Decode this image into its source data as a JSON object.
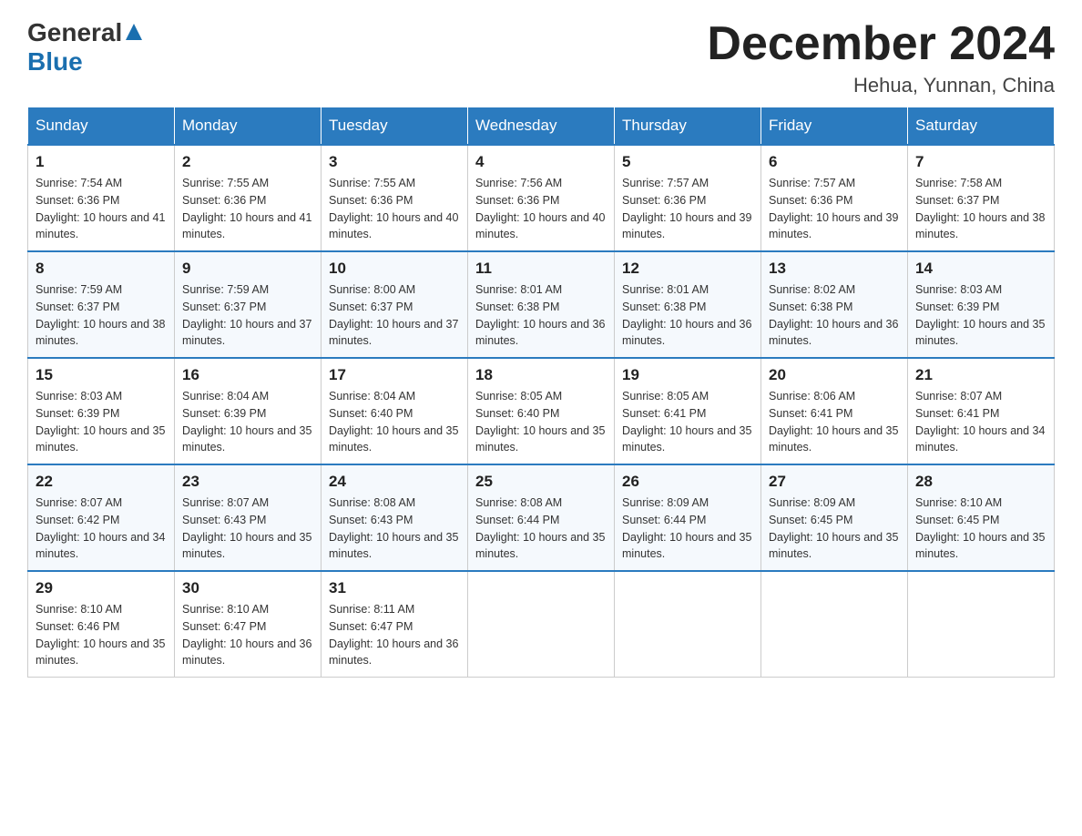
{
  "header": {
    "logo_general": "General",
    "logo_blue": "Blue",
    "month_title": "December 2024",
    "location": "Hehua, Yunnan, China"
  },
  "days_of_week": [
    "Sunday",
    "Monday",
    "Tuesday",
    "Wednesday",
    "Thursday",
    "Friday",
    "Saturday"
  ],
  "weeks": [
    [
      {
        "day": "1",
        "sunrise": "7:54 AM",
        "sunset": "6:36 PM",
        "daylight": "10 hours and 41 minutes."
      },
      {
        "day": "2",
        "sunrise": "7:55 AM",
        "sunset": "6:36 PM",
        "daylight": "10 hours and 41 minutes."
      },
      {
        "day": "3",
        "sunrise": "7:55 AM",
        "sunset": "6:36 PM",
        "daylight": "10 hours and 40 minutes."
      },
      {
        "day": "4",
        "sunrise": "7:56 AM",
        "sunset": "6:36 PM",
        "daylight": "10 hours and 40 minutes."
      },
      {
        "day": "5",
        "sunrise": "7:57 AM",
        "sunset": "6:36 PM",
        "daylight": "10 hours and 39 minutes."
      },
      {
        "day": "6",
        "sunrise": "7:57 AM",
        "sunset": "6:36 PM",
        "daylight": "10 hours and 39 minutes."
      },
      {
        "day": "7",
        "sunrise": "7:58 AM",
        "sunset": "6:37 PM",
        "daylight": "10 hours and 38 minutes."
      }
    ],
    [
      {
        "day": "8",
        "sunrise": "7:59 AM",
        "sunset": "6:37 PM",
        "daylight": "10 hours and 38 minutes."
      },
      {
        "day": "9",
        "sunrise": "7:59 AM",
        "sunset": "6:37 PM",
        "daylight": "10 hours and 37 minutes."
      },
      {
        "day": "10",
        "sunrise": "8:00 AM",
        "sunset": "6:37 PM",
        "daylight": "10 hours and 37 minutes."
      },
      {
        "day": "11",
        "sunrise": "8:01 AM",
        "sunset": "6:38 PM",
        "daylight": "10 hours and 36 minutes."
      },
      {
        "day": "12",
        "sunrise": "8:01 AM",
        "sunset": "6:38 PM",
        "daylight": "10 hours and 36 minutes."
      },
      {
        "day": "13",
        "sunrise": "8:02 AM",
        "sunset": "6:38 PM",
        "daylight": "10 hours and 36 minutes."
      },
      {
        "day": "14",
        "sunrise": "8:03 AM",
        "sunset": "6:39 PM",
        "daylight": "10 hours and 35 minutes."
      }
    ],
    [
      {
        "day": "15",
        "sunrise": "8:03 AM",
        "sunset": "6:39 PM",
        "daylight": "10 hours and 35 minutes."
      },
      {
        "day": "16",
        "sunrise": "8:04 AM",
        "sunset": "6:39 PM",
        "daylight": "10 hours and 35 minutes."
      },
      {
        "day": "17",
        "sunrise": "8:04 AM",
        "sunset": "6:40 PM",
        "daylight": "10 hours and 35 minutes."
      },
      {
        "day": "18",
        "sunrise": "8:05 AM",
        "sunset": "6:40 PM",
        "daylight": "10 hours and 35 minutes."
      },
      {
        "day": "19",
        "sunrise": "8:05 AM",
        "sunset": "6:41 PM",
        "daylight": "10 hours and 35 minutes."
      },
      {
        "day": "20",
        "sunrise": "8:06 AM",
        "sunset": "6:41 PM",
        "daylight": "10 hours and 35 minutes."
      },
      {
        "day": "21",
        "sunrise": "8:07 AM",
        "sunset": "6:41 PM",
        "daylight": "10 hours and 34 minutes."
      }
    ],
    [
      {
        "day": "22",
        "sunrise": "8:07 AM",
        "sunset": "6:42 PM",
        "daylight": "10 hours and 34 minutes."
      },
      {
        "day": "23",
        "sunrise": "8:07 AM",
        "sunset": "6:43 PM",
        "daylight": "10 hours and 35 minutes."
      },
      {
        "day": "24",
        "sunrise": "8:08 AM",
        "sunset": "6:43 PM",
        "daylight": "10 hours and 35 minutes."
      },
      {
        "day": "25",
        "sunrise": "8:08 AM",
        "sunset": "6:44 PM",
        "daylight": "10 hours and 35 minutes."
      },
      {
        "day": "26",
        "sunrise": "8:09 AM",
        "sunset": "6:44 PM",
        "daylight": "10 hours and 35 minutes."
      },
      {
        "day": "27",
        "sunrise": "8:09 AM",
        "sunset": "6:45 PM",
        "daylight": "10 hours and 35 minutes."
      },
      {
        "day": "28",
        "sunrise": "8:10 AM",
        "sunset": "6:45 PM",
        "daylight": "10 hours and 35 minutes."
      }
    ],
    [
      {
        "day": "29",
        "sunrise": "8:10 AM",
        "sunset": "6:46 PM",
        "daylight": "10 hours and 35 minutes."
      },
      {
        "day": "30",
        "sunrise": "8:10 AM",
        "sunset": "6:47 PM",
        "daylight": "10 hours and 36 minutes."
      },
      {
        "day": "31",
        "sunrise": "8:11 AM",
        "sunset": "6:47 PM",
        "daylight": "10 hours and 36 minutes."
      },
      null,
      null,
      null,
      null
    ]
  ]
}
